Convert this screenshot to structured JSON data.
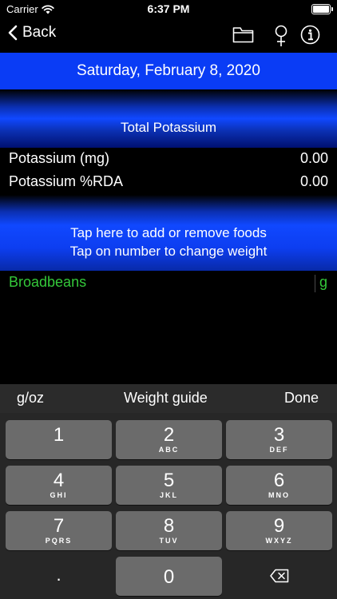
{
  "status": {
    "carrier": "Carrier",
    "time": "6:37 PM",
    "battery_level": 1.0
  },
  "nav": {
    "back_label": "Back",
    "icons": [
      "folder-icon",
      "female-icon",
      "info-icon"
    ]
  },
  "date": "Saturday, February 8, 2020",
  "total_title": "Total Potassium",
  "nutrients": [
    {
      "label": "Potassium (mg)",
      "value": "0.00"
    },
    {
      "label": "Potassium %RDA",
      "value": "0.00"
    }
  ],
  "tap": {
    "line1": "Tap here to add or remove foods",
    "line2": "Tap on number to change weight"
  },
  "food": {
    "name": "Broadbeans",
    "unit": "g"
  },
  "keyboard_toolbar": {
    "left": "g/oz",
    "center": "Weight guide",
    "right": "Done"
  },
  "keys": [
    {
      "num": "1",
      "sub": ""
    },
    {
      "num": "2",
      "sub": "ABC"
    },
    {
      "num": "3",
      "sub": "DEF"
    },
    {
      "num": "4",
      "sub": "GHI"
    },
    {
      "num": "5",
      "sub": "JKL"
    },
    {
      "num": "6",
      "sub": "MNO"
    },
    {
      "num": "7",
      "sub": "PQRS"
    },
    {
      "num": "8",
      "sub": "TUV"
    },
    {
      "num": "9",
      "sub": "WXYZ"
    },
    {
      "num": "0",
      "sub": ""
    }
  ],
  "decimal_key": ".",
  "colors": {
    "accent_blue": "#0a3cf5",
    "food_green": "#34c83a",
    "key_gray": "#6b6b6b"
  }
}
